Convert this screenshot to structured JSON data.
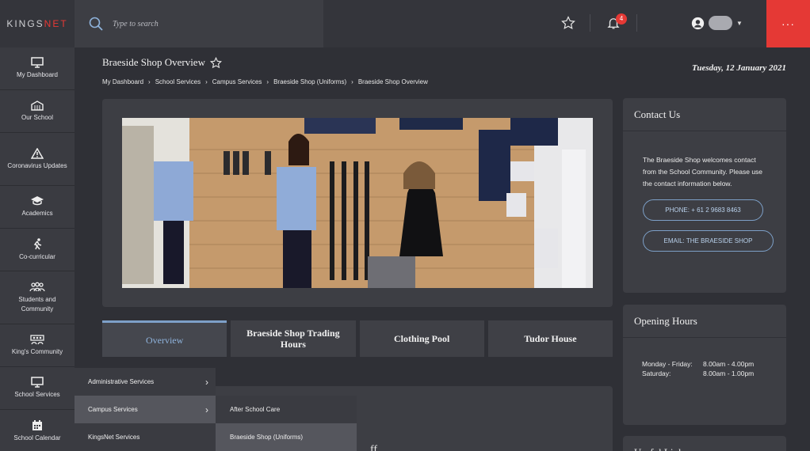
{
  "brand": {
    "logo_text_main": "KINGS",
    "logo_text_accent": "NET"
  },
  "search": {
    "placeholder": "Type to search"
  },
  "header": {
    "notifications_count": "4",
    "more_label": "···"
  },
  "sidebar": {
    "items": [
      {
        "label": "My Dashboard",
        "icon": "monitor-icon"
      },
      {
        "label": "Our School",
        "icon": "school-icon"
      },
      {
        "label": "Coronavirus Updates",
        "icon": "warning-icon"
      },
      {
        "label": "Academics",
        "icon": "graduation-cap-icon"
      },
      {
        "label": "Co-curricular",
        "icon": "running-icon"
      },
      {
        "label": "Students and Community",
        "icon": "people-icon"
      },
      {
        "label": "King's Community",
        "icon": "group-icon"
      },
      {
        "label": "School Services",
        "icon": "monitor-icon"
      },
      {
        "label": "School Calendar",
        "icon": "calendar-icon"
      }
    ]
  },
  "page": {
    "title": "Braeside Shop Overview",
    "date": "Tuesday, 12 January 2021"
  },
  "breadcrumbs": [
    "My Dashboard",
    "School Services",
    "Campus Services",
    "Braeside Shop (Uniforms)",
    "Braeside Shop Overview"
  ],
  "tabs": [
    {
      "label": "Overview",
      "active": true
    },
    {
      "label": "Braeside Shop Trading Hours",
      "active": false
    },
    {
      "label": "Clothing Pool",
      "active": false
    },
    {
      "label": "Tudor House",
      "active": false
    }
  ],
  "content": {
    "partial_text": "ff..."
  },
  "contact": {
    "title": "Contact Us",
    "text": "The Braeside Shop welcomes contact from the School Community. Please use the contact information below.",
    "phone_label": "PHONE: + 61 2 9683 8463",
    "email_label": "EMAIL: THE BRAESIDE SHOP"
  },
  "opening_hours": {
    "title": "Opening Hours",
    "rows": [
      {
        "day": "Monday - Friday:",
        "time": "8.00am - 4.00pm"
      },
      {
        "day": "Saturday:",
        "time": "8.00am - 1.00pm"
      }
    ]
  },
  "useful_links": {
    "title": "Useful Links"
  },
  "menu_level1": [
    {
      "label": "Administrative Services",
      "has_children": true,
      "selected": false
    },
    {
      "label": "Campus Services",
      "has_children": true,
      "selected": true
    },
    {
      "label": "KingsNet Services",
      "has_children": false,
      "selected": false
    }
  ],
  "menu_level2": [
    {
      "label": "After School Care",
      "selected": false
    },
    {
      "label": "Braeside Shop (Uniforms)",
      "selected": true
    }
  ],
  "colors": {
    "accent_red": "#e53935",
    "accent_blue": "#7da0c8",
    "bg": "#2f3036"
  }
}
